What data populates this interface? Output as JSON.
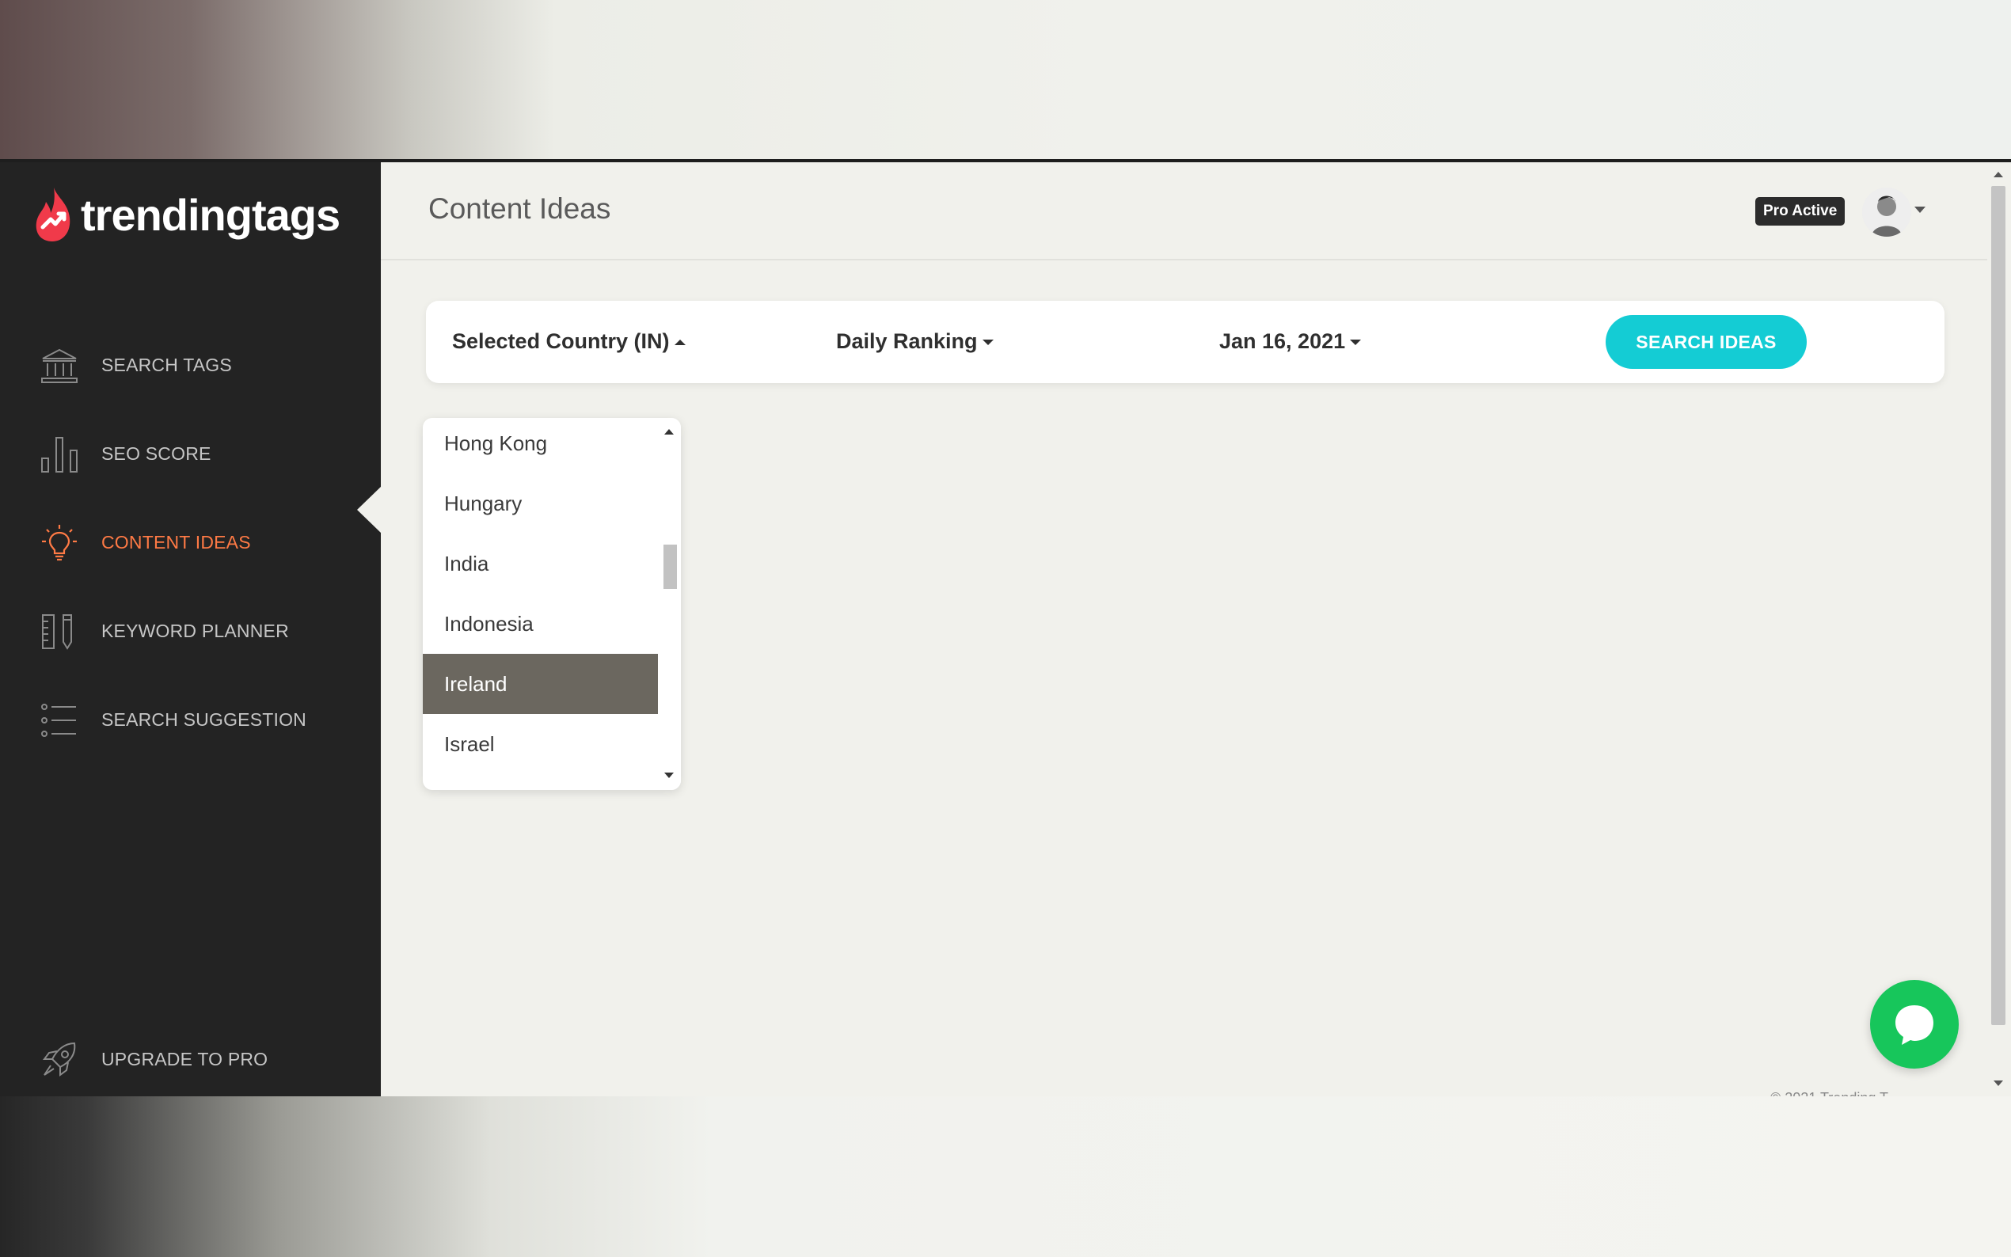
{
  "brand": {
    "name": "trendingtags",
    "accent_color": "#ff7a45",
    "logo_color": "#f03a4a"
  },
  "sidebar": {
    "items": [
      {
        "label": "SEARCH TAGS",
        "icon": "bank-icon",
        "active": false
      },
      {
        "label": "SEO SCORE",
        "icon": "bar-chart-icon",
        "active": false
      },
      {
        "label": "CONTENT IDEAS",
        "icon": "lightbulb-icon",
        "active": true
      },
      {
        "label": "KEYWORD PLANNER",
        "icon": "ruler-pencil-icon",
        "active": false
      },
      {
        "label": "SEARCH SUGGESTION",
        "icon": "list-icon",
        "active": false
      }
    ],
    "upgrade": {
      "label": "UPGRADE TO PRO",
      "icon": "rocket-icon"
    }
  },
  "header": {
    "title": "Content Ideas",
    "badge": "Pro Active"
  },
  "filters": {
    "country": "Selected Country (IN)",
    "ranking": "Daily Ranking",
    "date": "Jan 16, 2021",
    "search_button": "SEARCH IDEAS",
    "button_color": "#14ccd4"
  },
  "country_list": {
    "items": [
      "Hong Kong",
      "Hungary",
      "India",
      "Indonesia",
      "Ireland",
      "Israel"
    ],
    "selected": "Ireland",
    "selected_color": "#6b675f"
  },
  "chat": {
    "icon": "chat-bubble-icon",
    "color": "#17c65b"
  },
  "footer": {
    "text": "© 2021 Trending T"
  }
}
